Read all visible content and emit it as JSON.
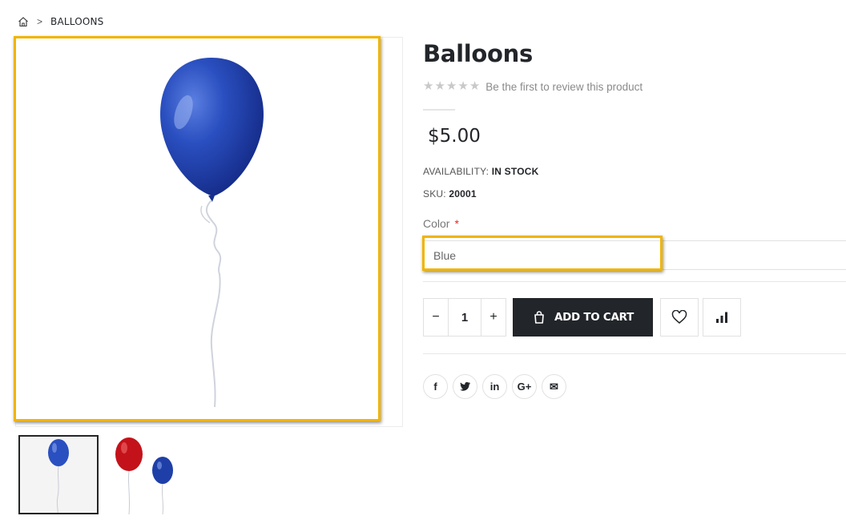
{
  "breadcrumb": {
    "home_icon": "home-icon",
    "separator": ">",
    "current": "BALLOONS"
  },
  "product": {
    "title": "Balloons",
    "rating_stars": 0,
    "review_link": "Be the first to review this product",
    "price": "$5.00",
    "availability_label": "AVAILABILITY:",
    "availability_value": "IN STOCK",
    "sku_label": "SKU:",
    "sku_value": "20001",
    "color_label": "Color",
    "required_mark": "*",
    "color_selected": "Blue",
    "quantity": "1",
    "qty_minus": "−",
    "qty_plus": "+",
    "add_to_cart": "ADD TO CART"
  },
  "gallery": {
    "main_image": "blue-balloon-image",
    "thumbnails": [
      "blue-balloon-thumb",
      "red-and-blue-balloons-thumb"
    ]
  },
  "share": {
    "items": [
      {
        "icon": "facebook-icon",
        "glyph": "f"
      },
      {
        "icon": "twitter-icon",
        "glyph": "🐦"
      },
      {
        "icon": "linkedin-icon",
        "glyph": "in"
      },
      {
        "icon": "google-plus-icon",
        "glyph": "G+"
      },
      {
        "icon": "email-icon",
        "glyph": "✉"
      }
    ]
  },
  "colors": {
    "highlight": "#f0b400",
    "primary_dark": "#222529",
    "balloon_blue": "#1f3fa8",
    "balloon_red": "#c4121a",
    "required": "#e02b27"
  }
}
